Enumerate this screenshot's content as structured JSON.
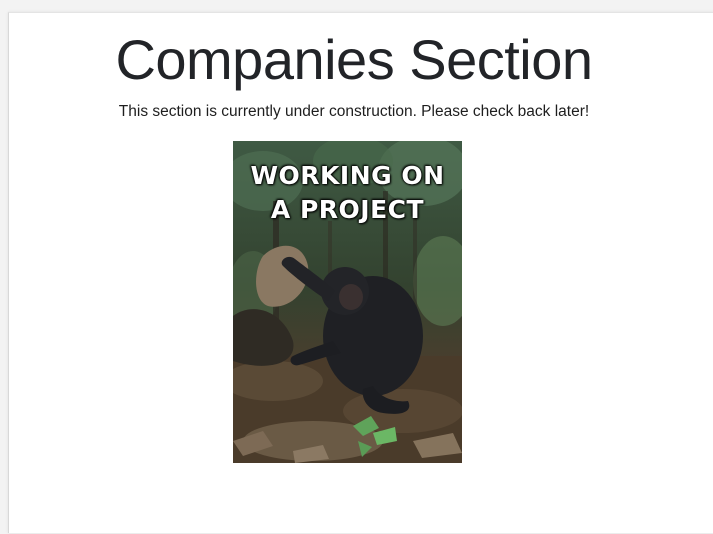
{
  "page": {
    "heading": "Companies Section",
    "message": "This section is currently under construction. Please check back later!"
  },
  "gif": {
    "caption_line1": "WORKING ON",
    "caption_line2": "A PROJECT"
  },
  "colors": {
    "background": "#ffffff",
    "heading_text": "#222428",
    "body_text": "#1e1e1e",
    "caption_text": "#ffffff"
  }
}
